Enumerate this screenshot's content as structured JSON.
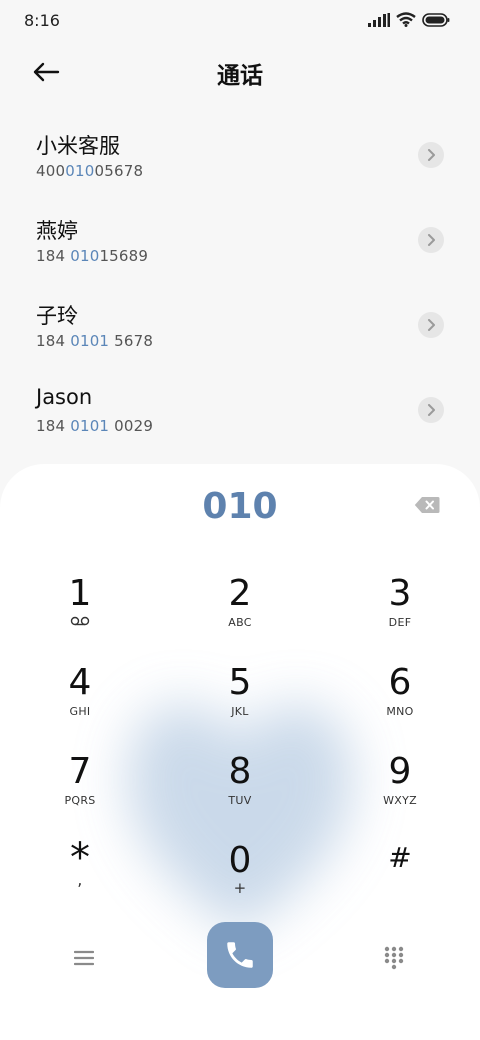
{
  "status": {
    "time": "8:16"
  },
  "header": {
    "title": "通话"
  },
  "contacts": [
    {
      "name": "小米客服",
      "num_pre": "400",
      "num_hl": "010",
      "num_post": "05678"
    },
    {
      "name": "燕婷",
      "num_pre": "184 ",
      "num_hl": "010",
      "num_post": "15689"
    },
    {
      "name": "子玲",
      "num_pre": "184 ",
      "num_hl": "0101",
      "num_post": " 5678"
    },
    {
      "name": "Jason",
      "num_pre": "184 ",
      "num_hl": "0101",
      "num_post": " 0029"
    }
  ],
  "dialpad": {
    "entered": "010",
    "keys": [
      {
        "main": "1",
        "sub": "voicemail-icon"
      },
      {
        "main": "2",
        "sub": "ABC"
      },
      {
        "main": "3",
        "sub": "DEF"
      },
      {
        "main": "4",
        "sub": "GHI"
      },
      {
        "main": "5",
        "sub": "JKL"
      },
      {
        "main": "6",
        "sub": "MNO"
      },
      {
        "main": "7",
        "sub": "PQRS"
      },
      {
        "main": "8",
        "sub": "TUV"
      },
      {
        "main": "9",
        "sub": "WXYZ"
      },
      {
        "main": "*",
        "sub": ","
      },
      {
        "main": "0",
        "sub": "+"
      },
      {
        "main": "#",
        "sub": ""
      }
    ]
  },
  "colors": {
    "accent": "#5e82ae",
    "call_button": "#7d9cc0",
    "highlight": "#5b86b8"
  },
  "icons": {
    "back": "arrow-left-icon",
    "chevron": "chevron-right-icon",
    "backspace": "backspace-icon",
    "menu": "menu-icon",
    "call": "phone-icon",
    "dialpad": "dialpad-grid-icon"
  }
}
